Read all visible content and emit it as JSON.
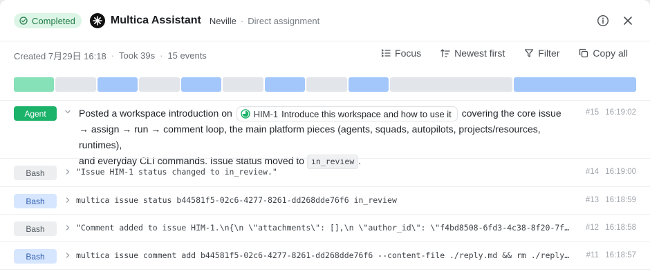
{
  "header": {
    "status": "Completed",
    "agent_name": "Multica Assistant",
    "owner": "Neville",
    "separator": "·",
    "assignment": "Direct assignment",
    "info_icon": "info-icon",
    "close_icon": "close-icon"
  },
  "meta": {
    "created": "Created 7月29日 16:18",
    "duration": "Took 39s",
    "events": "15 events",
    "dot": "·"
  },
  "toolbar": {
    "focus": "Focus",
    "sort": "Newest first",
    "filter": "Filter",
    "copy": "Copy all"
  },
  "timeline": {
    "segments": [
      {
        "weight": 58,
        "color": "#86e0b8"
      },
      {
        "weight": 58,
        "color": "#e2e5ea"
      },
      {
        "weight": 58,
        "color": "#a3c7fb"
      },
      {
        "weight": 58,
        "color": "#e2e5ea"
      },
      {
        "weight": 58,
        "color": "#a3c7fb"
      },
      {
        "weight": 58,
        "color": "#e2e5ea"
      },
      {
        "weight": 58,
        "color": "#a3c7fb"
      },
      {
        "weight": 58,
        "color": "#e2e5ea"
      },
      {
        "weight": 58,
        "color": "#a3c7fb"
      },
      {
        "weight": 175,
        "color": "#e2e5ea"
      },
      {
        "weight": 176,
        "color": "#a3c7fb"
      }
    ]
  },
  "events": {
    "e15": {
      "type": "Agent",
      "text_before": "Posted a workspace introduction on",
      "chip_id": "HIM-1",
      "chip_title": "Introduce this workspace and how to use it",
      "text_after": "covering the core issue",
      "line2": "→ assign → run → comment loop, the main platform pieces (agents, squads, autopilots, projects/resources, runtimes),",
      "line3_before": "and everyday CLI commands. Issue status moved to",
      "code": "in_review",
      "line3_after": ".",
      "num": "#15",
      "time": "16:19:02"
    },
    "e14": {
      "type": "Bash",
      "text": "\"Issue HIM-1 status changed to in_review.\"",
      "num": "#14",
      "time": "16:19:00"
    },
    "e13": {
      "type": "Bash",
      "text": "multica issue status b44581f5-02c6-4277-8261-dd268dde76f6 in_review",
      "num": "#13",
      "time": "16:18:59"
    },
    "e12": {
      "type": "Bash",
      "text": "\"Comment added to issue HIM-1.\\n{\\n  \\\"attachments\\\": [],\\n  \\\"author_id\\\": \\\"f4bd8508-6fd3-4c38-8f20-7ffd…",
      "num": "#12",
      "time": "16:18:58"
    },
    "e11": {
      "type": "Bash",
      "text": "multica issue comment add b44581f5-02c6-4277-8261-dd268dde76f6 --content-file ./reply.md && rm ./reply.md",
      "num": "#11",
      "time": "16:18:57"
    }
  }
}
